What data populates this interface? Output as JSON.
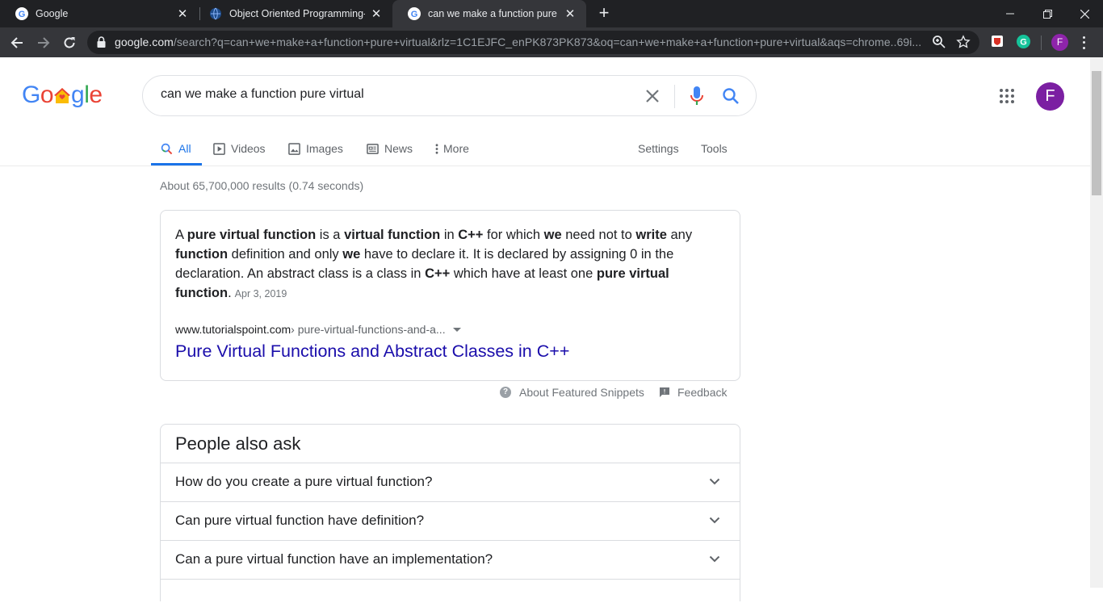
{
  "browser": {
    "tabs": [
      {
        "title": "Google",
        "active": false
      },
      {
        "title": "Object Oriented Programming-Z",
        "active": false
      },
      {
        "title": "can we make a function pure virtu",
        "active": true
      }
    ],
    "url_host": "google.com",
    "url_rest": "/search?q=can+we+make+a+function+pure+virtual&rlz=1C1EJFC_enPK873PK873&oq=can+we+make+a+function+pure+virtual&aqs=chrome..69i...",
    "profile_initial": "F"
  },
  "google": {
    "logo_letters": [
      "G",
      "o",
      "o",
      "g",
      "l",
      "e"
    ],
    "logo_colors": [
      "#4285f4",
      "#ea4335",
      "#fbbc05",
      "#4285f4",
      "#34a853",
      "#ea4335"
    ],
    "query": "can we make a function pure virtual",
    "profile_initial": "F",
    "tabs": {
      "all": "All",
      "videos": "Videos",
      "images": "Images",
      "news": "News",
      "more": "More",
      "settings": "Settings",
      "tools": "Tools"
    },
    "stats": "About 65,700,000 results (0.74 seconds)"
  },
  "featured": {
    "snippet": {
      "t1": "A ",
      "b1": "pure virtual function",
      "t2": " is a ",
      "b2": "virtual function",
      "t3": " in ",
      "b3": "C++",
      "t4": " for which ",
      "b4": "we",
      "t5": " need not to ",
      "b5": "write",
      "t6": " any ",
      "b6": "function",
      "t7": " definition and only ",
      "b7": "we",
      "t8": " have to declare it. It is declared by assigning 0 in the declaration. An abstract class is a class in ",
      "b8": "C++",
      "t9": " which have at least one ",
      "b9": "pure virtual function",
      "t10": "."
    },
    "date": "Apr 3, 2019",
    "cite_host": "www.tutorialspoint.com",
    "cite_path": " › pure-virtual-functions-and-a...",
    "title": "Pure Virtual Functions and Abstract Classes in C++",
    "about_label": "About Featured Snippets",
    "feedback_label": "Feedback"
  },
  "people_also_ask": {
    "title": "People also ask",
    "questions": [
      "How do you create a pure virtual function?",
      "Can pure virtual function have definition?",
      "Can a pure virtual function have an implementation?"
    ]
  }
}
